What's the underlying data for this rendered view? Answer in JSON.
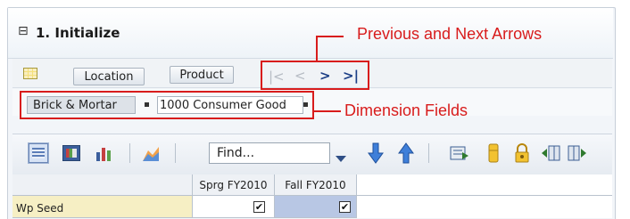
{
  "section": {
    "collapse_glyph": "⊟",
    "title": "1. Initialize"
  },
  "toolbar1": {
    "location_label": "Location",
    "product_label": "Product",
    "nav": {
      "first": "|<",
      "prev": "<",
      "next": ">",
      "last": ">|"
    }
  },
  "dimensions": {
    "field1": "Brick & Mortar",
    "field2": "1000 Consumer Good"
  },
  "annotations": {
    "nav_callout": "Previous and Next Arrows",
    "dim_callout": "Dimension Fields",
    "accent_color": "#d81c1c"
  },
  "toolbar2": {
    "find_placeholder": "Find...",
    "icons": [
      "table-view-icon",
      "chart-table-icon",
      "bar-chart-icon",
      "area-chart-icon",
      "dropdown-arrow-icon",
      "down-arrow-icon",
      "up-arrow-icon",
      "export-icon",
      "pin-icon",
      "lock-icon",
      "move-columns-left-icon",
      "move-columns-right-icon"
    ]
  },
  "grid": {
    "columns": [
      "Sprg FY2010",
      "Fall FY2010"
    ],
    "rows": [
      {
        "label": "Wp Seed",
        "values": [
          true,
          true
        ]
      }
    ]
  }
}
